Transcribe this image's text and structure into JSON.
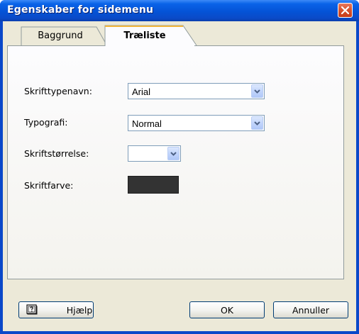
{
  "window": {
    "title": "Egenskaber for sidemenu"
  },
  "tabs": [
    {
      "label": "Baggrund",
      "active": false
    },
    {
      "label": "Træliste",
      "active": true
    }
  ],
  "fields": {
    "font_name": {
      "label": "Skrifttypenavn:",
      "value": "Arial"
    },
    "typography": {
      "label": "Typografi:",
      "value": "Normal"
    },
    "font_size": {
      "label": "Skriftstørrelse:",
      "value": ""
    },
    "font_color": {
      "label": "Skriftfarve:",
      "color": "#333333"
    }
  },
  "buttons": {
    "help": "Hjælp",
    "ok": "OK",
    "cancel": "Annuller"
  },
  "icons": {
    "close": "close-icon",
    "help": "help-book-icon",
    "dropdown": "chevron-down-icon"
  },
  "colors": {
    "titlebar": "#0453d6",
    "client_bg": "#ece9d8",
    "close_button": "#d8542f"
  }
}
